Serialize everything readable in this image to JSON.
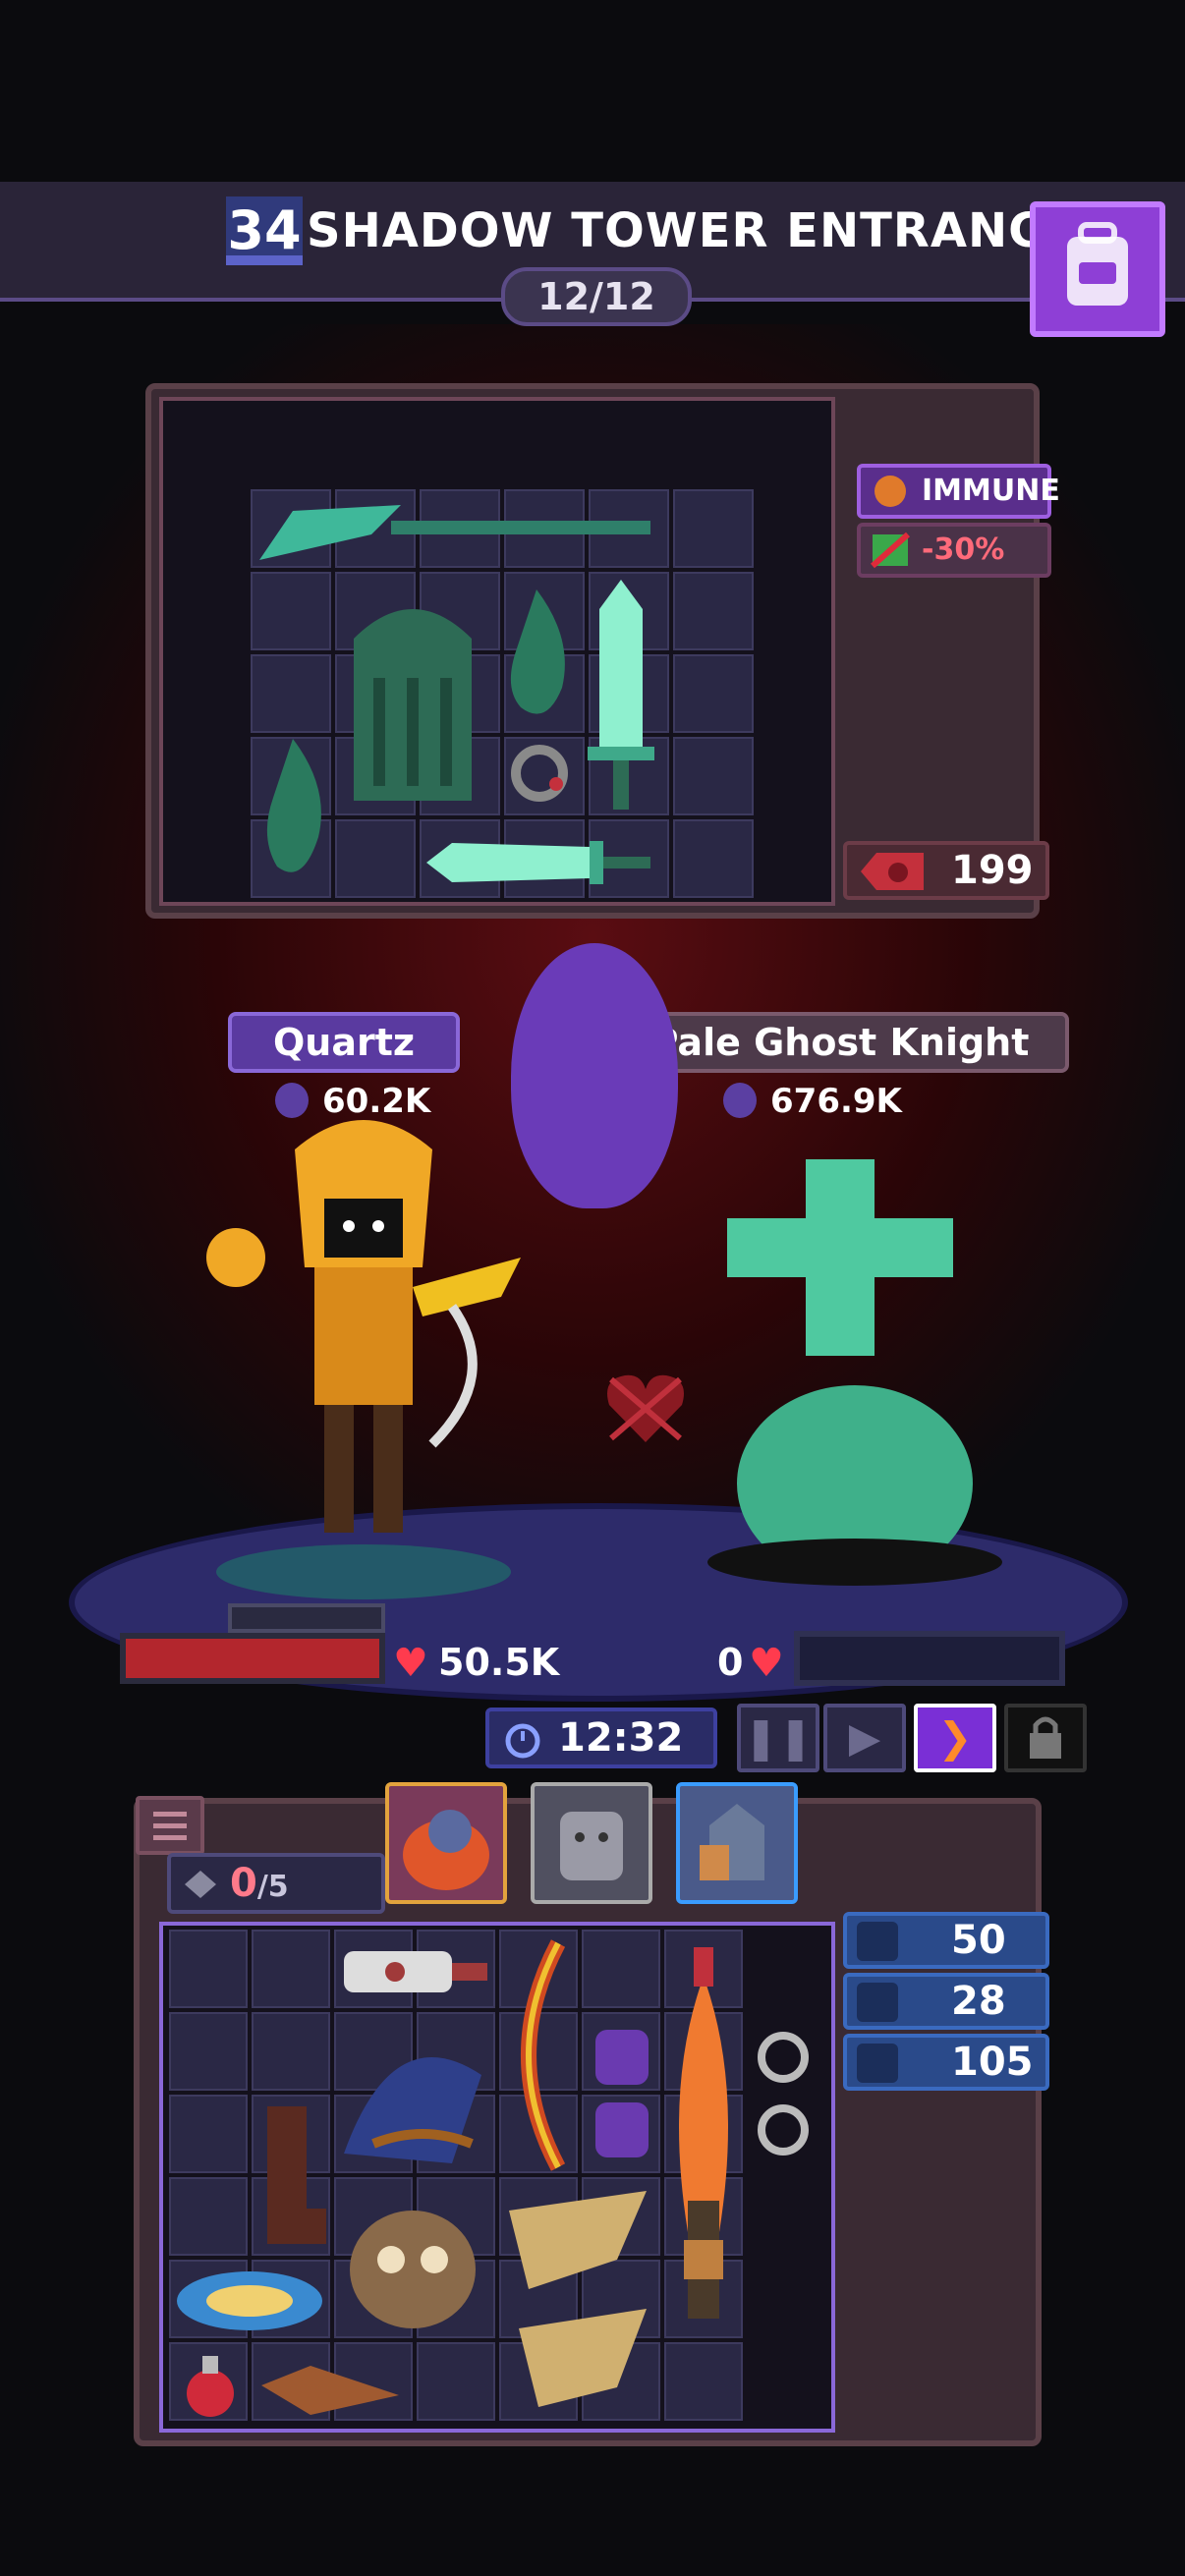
{
  "header": {
    "level": "34",
    "title": "SHADOW TOWER ENTRANCE",
    "wave": "12/12"
  },
  "enemy_panel": {
    "status_immune": "IMMUNE",
    "status_modifier": "-30%",
    "gold": "199"
  },
  "player": {
    "name": "Quartz",
    "power": "60.2K",
    "hp": "50.5K"
  },
  "enemy": {
    "name": "Pale Ghost Knight",
    "power": "676.9K",
    "hp": "0"
  },
  "controls": {
    "timer": "12:32"
  },
  "bag": {
    "slots_used": "0",
    "slots_max": "/5",
    "stats": [
      "50",
      "28",
      "105"
    ]
  },
  "colors": {
    "accent_purple": "#8e3fd6",
    "enemy_red": "#b3262d",
    "stat_blue": "#2a4a8a"
  }
}
